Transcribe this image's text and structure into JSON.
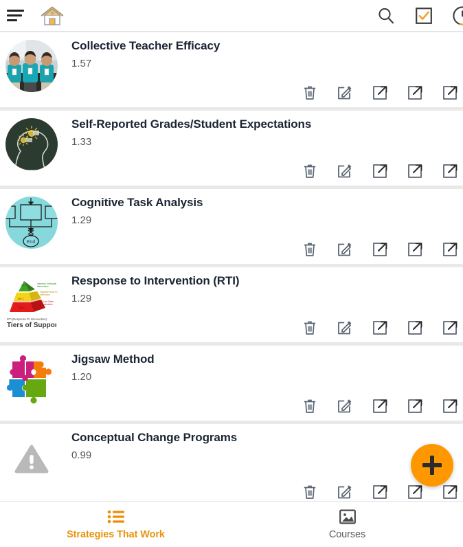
{
  "header": {
    "menu_icon": "hamburger-menu-icon",
    "home_icon": "home-icon",
    "search_icon": "search-icon",
    "checkbox_icon": "checkbox-checked-icon",
    "history_icon": "clock-history-icon"
  },
  "list": {
    "items": [
      {
        "title": "Collective Teacher Efficacy",
        "score": "1.57",
        "thumb": "photo-teachers-teal-shirts"
      },
      {
        "title": "Self-Reported Grades/Student Expectations",
        "score": "1.33",
        "thumb": "chalkboard-head-lightbulbs"
      },
      {
        "title": "Cognitive Task Analysis",
        "score": "1.29",
        "thumb": "flowchart-diagram-teal"
      },
      {
        "title": "Response to Intervention (RTI)",
        "score": "1.29",
        "thumb": "rti-tiered-pyramid"
      },
      {
        "title": "Jigsaw Method",
        "score": "1.20",
        "thumb": "jigsaw-puzzle-pieces"
      },
      {
        "title": "Conceptual Change Programs",
        "score": "0.99",
        "thumb": "broken-image-warning-placeholder"
      }
    ],
    "actions": [
      {
        "name": "delete-button",
        "icon": "trash-icon"
      },
      {
        "name": "edit-button",
        "icon": "pencil-square-icon"
      },
      {
        "name": "open-link-1-button",
        "icon": "external-link-icon"
      },
      {
        "name": "open-link-2-button",
        "icon": "external-link-icon"
      },
      {
        "name": "open-link-3-button",
        "icon": "external-link-icon"
      }
    ]
  },
  "fab": {
    "label": "+",
    "name": "add-strategy-button",
    "color": "#FF9800"
  },
  "bottom_nav": {
    "items": [
      {
        "label": "Strategies That Work",
        "icon": "list-icon",
        "active": true
      },
      {
        "label": "Courses",
        "icon": "image-icon",
        "active": false
      }
    ]
  },
  "colors": {
    "accent": "#FF9800",
    "accent_text": "#E8940C",
    "title": "#1A2433",
    "score": "#575757",
    "icon": "#5A6472",
    "page_bg": "#E9E9E9"
  }
}
